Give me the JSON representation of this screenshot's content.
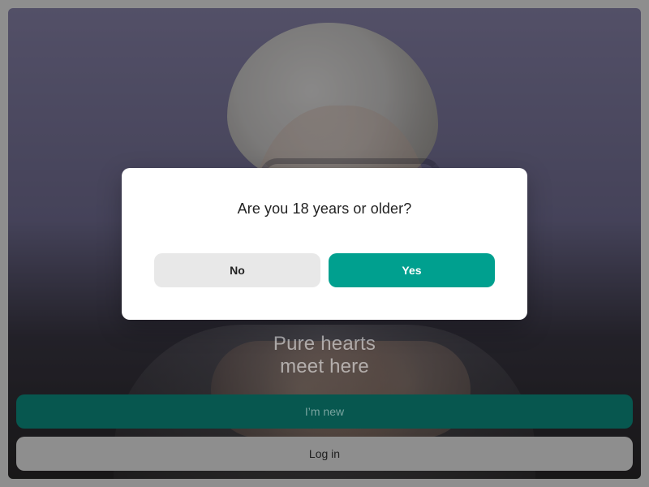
{
  "tagline": {
    "line1": "Pure hearts",
    "line2": "meet here"
  },
  "actions": {
    "new_label": "I’m new",
    "login_label": "Log in"
  },
  "age_gate": {
    "question": "Are you 18 years or older?",
    "no_label": "No",
    "yes_label": "Yes"
  },
  "colors": {
    "accent": "#00a08f",
    "accent_dark": "#07574f",
    "overlay": "rgba(0,0,0,0.42)"
  }
}
